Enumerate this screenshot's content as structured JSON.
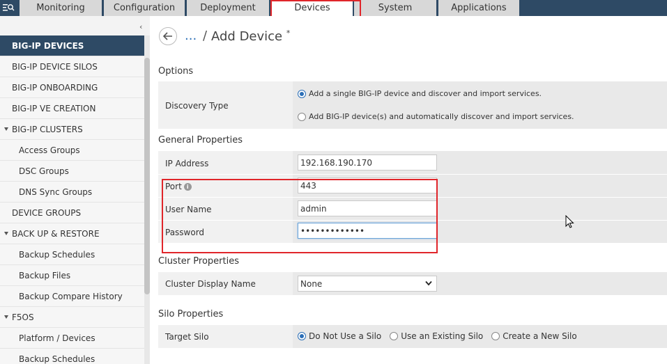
{
  "topnav": {
    "tabs": [
      {
        "label": "Monitoring"
      },
      {
        "label": "Configuration"
      },
      {
        "label": "Deployment"
      },
      {
        "label": "Devices"
      },
      {
        "label": "System"
      },
      {
        "label": "Applications"
      }
    ],
    "active_tab": "Devices"
  },
  "sidebar": {
    "items": [
      {
        "label": "BIG-IP DEVICES"
      },
      {
        "label": "BIG-IP DEVICE SILOS"
      },
      {
        "label": "BIG-IP ONBOARDING"
      },
      {
        "label": "BIG-IP VE CREATION"
      },
      {
        "label": "BIG-IP CLUSTERS"
      },
      {
        "label": "Access Groups"
      },
      {
        "label": "DSC Groups"
      },
      {
        "label": "DNS Sync Groups"
      },
      {
        "label": "DEVICE GROUPS"
      },
      {
        "label": "BACK UP & RESTORE"
      },
      {
        "label": "Backup Schedules"
      },
      {
        "label": "Backup Files"
      },
      {
        "label": "Backup Compare History"
      },
      {
        "label": "F5OS"
      },
      {
        "label": "Platform / Devices"
      },
      {
        "label": "Backup Schedules"
      }
    ]
  },
  "header": {
    "breadcrumb_link": "...",
    "separator": "/",
    "title": "Add Device",
    "required_mark": "*"
  },
  "options": {
    "section_title": "Options",
    "discovery_label": "Discovery Type",
    "discovery_options": [
      {
        "label": "Add a single BIG-IP device and discover and import services."
      },
      {
        "label": "Add BIG-IP device(s) and automatically discover and import services."
      }
    ]
  },
  "general": {
    "section_title": "General Properties",
    "ip_label": "IP Address",
    "ip_value": "192.168.190.170",
    "port_label": "Port",
    "port_value": "443",
    "username_label": "User Name",
    "username_value": "admin",
    "password_label": "Password",
    "password_value": "•••••••••••••"
  },
  "cluster": {
    "section_title": "Cluster Properties",
    "display_name_label": "Cluster Display Name",
    "display_name_value": "None"
  },
  "silo": {
    "section_title": "Silo Properties",
    "target_label": "Target Silo",
    "options": [
      {
        "label": "Do Not Use a Silo"
      },
      {
        "label": "Use an Existing Silo"
      },
      {
        "label": "Create a New Silo"
      }
    ]
  },
  "colors": {
    "nav_bg": "#2e4a65",
    "highlight": "#e0252a",
    "link": "#2a6eb7"
  }
}
